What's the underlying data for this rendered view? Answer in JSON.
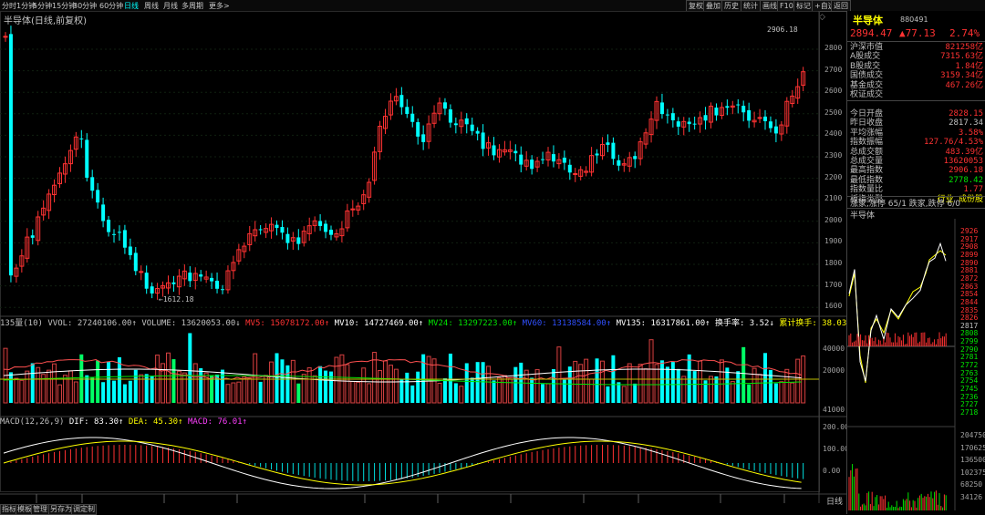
{
  "toolbar": {
    "periods": [
      "分时",
      "1分钟",
      "5分钟",
      "15分钟",
      "30分钟",
      "60分钟",
      "日线",
      "周线",
      "月线",
      "多周期",
      "更多>"
    ],
    "selected_period": "日线",
    "right_buttons": [
      "复权",
      "叠加",
      "历史",
      "统计",
      "画线",
      "F10",
      "标记",
      "+自选",
      "返回"
    ]
  },
  "chart": {
    "title": "半导体(日线,前复权)",
    "high_label": "2906.18",
    "low_label": "1612.18",
    "diamond": "◇",
    "price_ticks": [
      "2800",
      "2700",
      "2600",
      "2500",
      "2400",
      "2300",
      "2200",
      "2100",
      "2000",
      "1900",
      "1800",
      "1700",
      "1600"
    ]
  },
  "volume": {
    "legend_prefix": "135量(10)",
    "vvol": "VVOL: 27240106.00↑",
    "volume": "VOLUME: 13620053.00↓",
    "mv5": "MV5: 15078172.00↑",
    "mv10": "MV10: 14727469.00↑",
    "mv24": "MV24: 13297223.00↑",
    "mv60": "MV60: 13138584.00↑",
    "mv135": "MV135: 16317861.00↑",
    "turnover": "换手率: 3.52↓",
    "cum_turnover": "累计换手: 38.03",
    "ticks": [
      "40000",
      "20000",
      "41000"
    ]
  },
  "macd": {
    "legend": "MACD(12,26,9)",
    "dif": "DIF: 83.30↑",
    "dea": "DEA: 45.30↑",
    "macd": "MACD: 76.01↑",
    "ticks": [
      "200.00",
      "100.00",
      "0.00"
    ]
  },
  "bottom_tabs": [
    "指标",
    "模板",
    "管理",
    "另存为",
    "调定制"
  ],
  "bottom_period": "日线",
  "side": {
    "name": "半导体",
    "code": "880491",
    "price": "2894.47",
    "change": "▲77.13",
    "pct": "2.74%",
    "rows": [
      {
        "k": "沪深市值",
        "v": "821258亿",
        "c": "red"
      },
      {
        "k": "A股成交",
        "v": "7315.63亿",
        "c": "red"
      },
      {
        "k": "B股成交",
        "v": "1.84亿",
        "c": "red"
      },
      {
        "k": "国债成交",
        "v": "3159.34亿",
        "c": "red"
      },
      {
        "k": "基金成交",
        "v": "467.26亿",
        "c": "red"
      },
      {
        "k": "权证成交",
        "v": "",
        "c": "red"
      }
    ],
    "rows2": [
      {
        "k": "今日开盘",
        "v": "2828.15",
        "c": "red"
      },
      {
        "k": "昨日收盘",
        "v": "2817.34",
        "c": ""
      },
      {
        "k": "平均涨幅",
        "v": "3.58%",
        "c": "red"
      },
      {
        "k": "指数振幅",
        "v": "127.76/4.53%",
        "c": "red"
      },
      {
        "k": "总成交额",
        "v": "483.39亿",
        "c": "red"
      },
      {
        "k": "总成交量",
        "v": "13620053",
        "c": "red"
      },
      {
        "k": "最高指数",
        "v": "2906.18",
        "c": "red"
      },
      {
        "k": "最低指数",
        "v": "2778.42",
        "c": "green"
      },
      {
        "k": "指数量比",
        "v": "1.77",
        "c": "red"
      },
      {
        "k": "板指类型",
        "v": "行业 成份股",
        "c": "yellow"
      }
    ],
    "updown": "涨家,涨停 65/1 跌家,跌停 6/0",
    "mini_title": "半导体",
    "mini_ticks": [
      "2926",
      "2917",
      "2908",
      "2899",
      "2890",
      "2881",
      "2872",
      "2863",
      "2854",
      "2844",
      "2835",
      "2826",
      "2817",
      "2808",
      "2799",
      "2790",
      "2781",
      "2772",
      "2763",
      "2754",
      "2745",
      "2736",
      "2727",
      "2718"
    ],
    "mini_vol_ticks": [
      "204750",
      "170625",
      "136500",
      "102375",
      "68250",
      "34126"
    ]
  }
}
